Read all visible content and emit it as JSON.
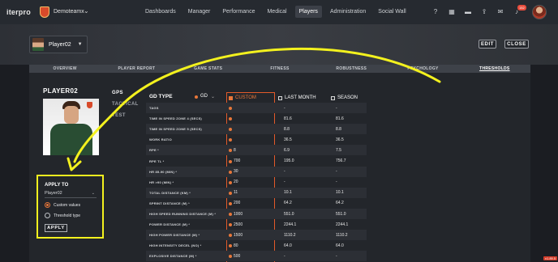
{
  "app": {
    "logo": "iterpro",
    "club_name": "Demoteamx",
    "notifications_count": "152",
    "version": "v1.89.5"
  },
  "nav": {
    "links": [
      "Dashboards",
      "Manager",
      "Performance",
      "Medical",
      "Players",
      "Administration",
      "Social Wall"
    ],
    "active": "Players"
  },
  "icons": [
    "help-icon",
    "calendar-icon",
    "folder-icon",
    "upload-icon",
    "chat-icon",
    "bell-icon"
  ],
  "player_selector": {
    "name": "Player02"
  },
  "actions": {
    "edit": "EDIT",
    "close": "CLOSE"
  },
  "tabs": {
    "items": [
      "OVERVIEW",
      "PLAYER REPORT",
      "GAME STATS",
      "FITNESS",
      "ROBUSTNESS",
      "PSYCHOLOGY",
      "THRESHOLDS"
    ],
    "active": "THRESHOLDS"
  },
  "player": {
    "title": "PLAYER02"
  },
  "sidenav": {
    "items": [
      "GPS",
      "TACTICAL",
      "TEST"
    ],
    "active": "GPS"
  },
  "apply_to": {
    "title": "APPLY TO",
    "selected_player": "Player02",
    "options": [
      "Custom values",
      "Threshold type"
    ],
    "selected_option": "Custom values",
    "button": "APPLY"
  },
  "thresholds": {
    "gd_type_label": "GD TYPE",
    "gd_type_value": "GD",
    "columns": [
      "CUSTOM",
      "LAST MONTH",
      "SEASON"
    ],
    "rows": [
      {
        "label": "TAGS",
        "custom": "",
        "last_month": "-",
        "season": "-"
      },
      {
        "label": "TIME IN SPEED ZONE 4 (SECS)",
        "custom": "",
        "last_month": "81.6",
        "season": "81.6"
      },
      {
        "label": "TIME IN SPEED ZONE 5 (SECS)",
        "custom": "",
        "last_month": "8.8",
        "season": "8.8"
      },
      {
        "label": "WORK RATIO",
        "custom": "",
        "last_month": "36.5",
        "season": "36.5"
      },
      {
        "label": "RPE *",
        "custom": "8",
        "last_month": "6.9",
        "season": "7.5"
      },
      {
        "label": "RPE TL *",
        "custom": "700",
        "last_month": "195.0",
        "season": "756.7"
      },
      {
        "label": "HR 85-90 (MIN) *",
        "custom": "30",
        "last_month": "-",
        "season": "-"
      },
      {
        "label": "HR >90 (MIN) *",
        "custom": "20",
        "last_month": "-",
        "season": "-"
      },
      {
        "label": "TOTAL DISTANCE (KM) *",
        "custom": "11",
        "last_month": "10.1",
        "season": "10.1"
      },
      {
        "label": "SPRINT DISTANCE (M) *",
        "custom": "200",
        "last_month": "64.2",
        "season": "64.2"
      },
      {
        "label": "HIGH SPEED RUNNING DISTANCE (M) *",
        "custom": "1000",
        "last_month": "551.0",
        "season": "551.0"
      },
      {
        "label": "POWER DISTANCE (M) *",
        "custom": "2500",
        "last_month": "2244.1",
        "season": "2244.1"
      },
      {
        "label": "HIGH POWER DISTANCE (M) *",
        "custom": "1500",
        "last_month": "1110.2",
        "season": "1110.2"
      },
      {
        "label": "HIGH INTENSITY DECEL (NO) *",
        "custom": "80",
        "last_month": "64.0",
        "season": "64.0"
      },
      {
        "label": "EXPLOSIVE DISTANCE (M) *",
        "custom": "500",
        "last_month": "-",
        "season": "-"
      }
    ]
  },
  "colors": {
    "accent": "#e8773a",
    "highlight": "#f3f11e",
    "custom_border": "#e25a2a"
  }
}
